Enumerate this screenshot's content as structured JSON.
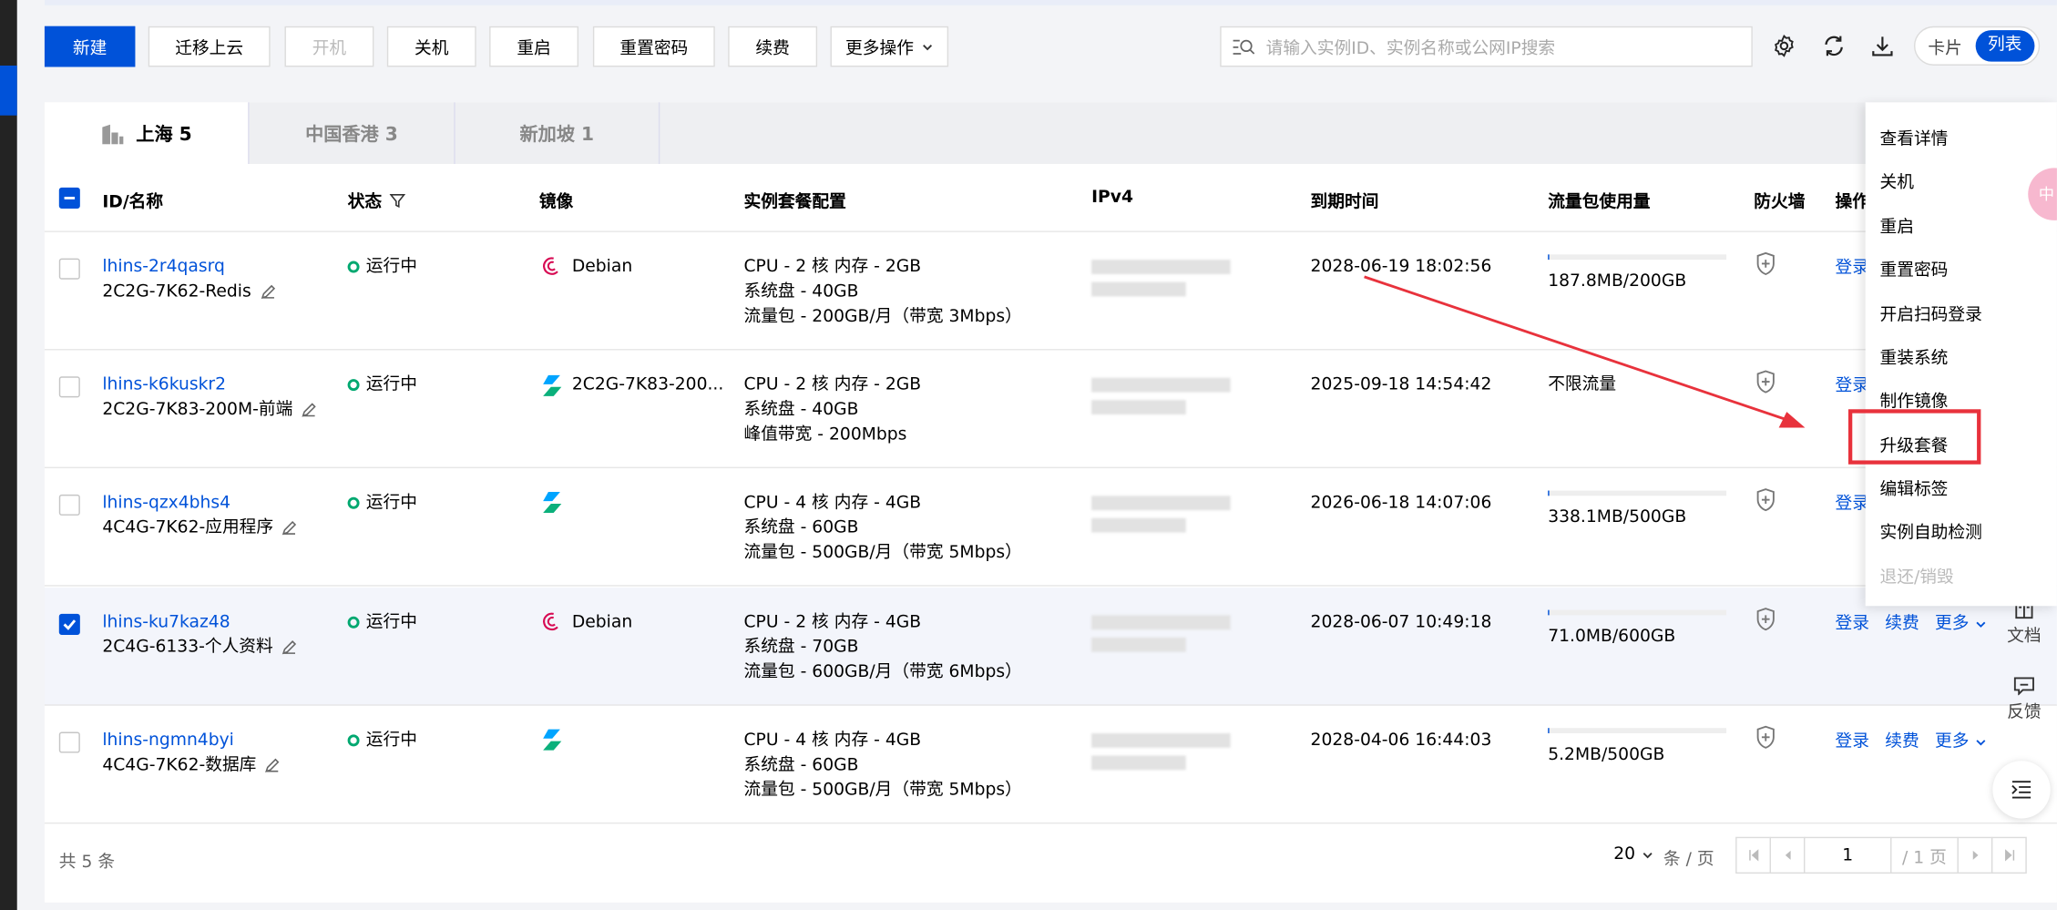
{
  "toolbar": {
    "new": "新建",
    "migrate": "迁移上云",
    "start": "开机",
    "shutdown": "关机",
    "restart": "重启",
    "reset_pwd": "重置密码",
    "renew": "续费",
    "more": "更多操作"
  },
  "search": {
    "placeholder": "请输入实例ID、实例名称或公网IP搜索"
  },
  "view_toggle": {
    "card": "卡片",
    "list": "列表",
    "active": "list"
  },
  "regions": [
    {
      "label": "上海 5",
      "active": true
    },
    {
      "label": "中国香港 3"
    },
    {
      "label": "新加坡 1"
    }
  ],
  "columns": {
    "id": "ID/名称",
    "status": "状态",
    "image": "镜像",
    "config": "实例套餐配置",
    "ipv4": "IPv4",
    "expire": "到期时间",
    "traffic": "流量包使用量",
    "firewall": "防火墙",
    "ops": "操作"
  },
  "rows": [
    {
      "id": "lhins-2r4qasrq",
      "name": "2C2G-7K62-Redis",
      "status": "运行中",
      "image": "Debian",
      "config": [
        "CPU - 2 核 内存 - 2GB",
        "系统盘 - 40GB",
        "流量包 - 200GB/月（带宽 3Mbps）"
      ],
      "expire": "2028-06-19 18:02:56",
      "traffic": "187.8MB/200GB",
      "traffic_fraction": 0.01,
      "ops": [
        "登录"
      ],
      "checked": false
    },
    {
      "id": "lhins-k6kuskr2",
      "name": "2C2G-7K83-200M-前端",
      "status": "运行中",
      "image": "2C2G-7K83-200...",
      "config": [
        "CPU - 2 核 内存 - 2GB",
        "系统盘 - 40GB",
        "峰值带宽 - 200Mbps"
      ],
      "expire": "2025-09-18 14:54:42",
      "traffic": "不限流量",
      "ops": [
        "登录"
      ],
      "checked": false
    },
    {
      "id": "lhins-qzx4bhs4",
      "name": "4C4G-7K62-应用程序",
      "status": "运行中",
      "image": "",
      "config": [
        "CPU - 4 核 内存 - 4GB",
        "系统盘 - 60GB",
        "流量包 - 500GB/月（带宽 5Mbps）"
      ],
      "expire": "2026-06-18 14:07:06",
      "traffic": "338.1MB/500GB",
      "traffic_fraction": 0.01,
      "ops": [
        "登录"
      ],
      "checked": false
    },
    {
      "id": "lhins-ku7kaz48",
      "name": "2C4G-6133-个人资料",
      "status": "运行中",
      "image": "Debian",
      "config": [
        "CPU - 2 核 内存 - 4GB",
        "系统盘 - 70GB",
        "流量包 - 600GB/月（带宽 6Mbps）"
      ],
      "expire": "2028-06-07 10:49:18",
      "traffic": "71.0MB/600GB",
      "traffic_fraction": 0.0,
      "ops": [
        "登录",
        "续费",
        "更多"
      ],
      "checked": true
    },
    {
      "id": "lhins-ngmn4byi",
      "name": "4C4G-7K62-数据库",
      "status": "运行中",
      "image": "",
      "config": [
        "CPU - 4 核 内存 - 4GB",
        "系统盘 - 60GB",
        "流量包 - 500GB/月（带宽 5Mbps）"
      ],
      "expire": "2028-04-06 16:44:03",
      "traffic": "5.2MB/500GB",
      "traffic_fraction": 0.0,
      "ops": [
        "登录",
        "续费",
        "更多"
      ],
      "checked": false
    }
  ],
  "footer": {
    "total": "共 5 条",
    "page_size": "20",
    "per_page": "条 / 页",
    "page": "1",
    "total_pages": "/ 1 页"
  },
  "more_menu": [
    "查看详情",
    "关机",
    "重启",
    "重置密码",
    "开启扫码登录",
    "重装系统",
    "制作镜像",
    "升级套餐",
    "编辑标签",
    "实例自助检测",
    "退还/销毁"
  ],
  "side_tools": {
    "docs": "文档",
    "feedback": "反馈",
    "bubble": "中"
  },
  "colors": {
    "primary": "#0052d9",
    "running": "#00a870",
    "highlight": "#e8323c"
  }
}
